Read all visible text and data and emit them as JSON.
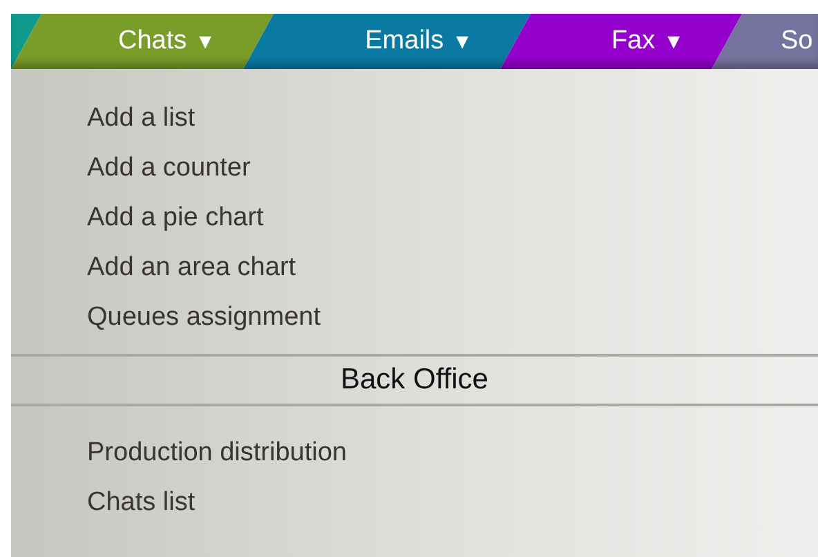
{
  "tabs": [
    {
      "color": "#0f9a8c"
    },
    {
      "label": "Chats",
      "caret": "▼",
      "color": "#7a9c28"
    },
    {
      "label": "Emails",
      "caret": "▼",
      "color": "#0a7aa2"
    },
    {
      "label": "Fax",
      "caret": "▼",
      "color": "#9400cc"
    },
    {
      "label": "So",
      "color": "#77739f"
    }
  ],
  "menu": {
    "items": [
      "Add a list",
      "Add a counter",
      "Add a pie chart",
      "Add an area chart",
      "Queues assignment"
    ],
    "section": {
      "title": "Back Office",
      "items": [
        "Production distribution",
        "Chats list"
      ]
    }
  }
}
